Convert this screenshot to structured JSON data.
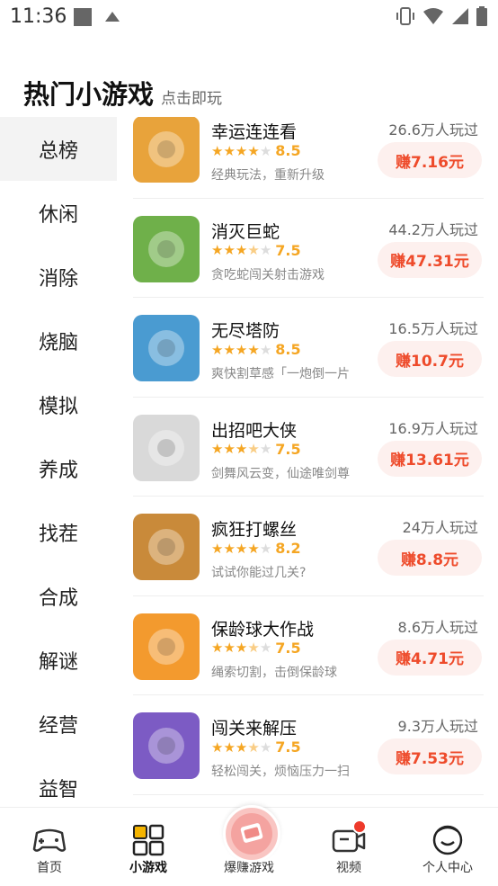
{
  "status": {
    "time": "11:36"
  },
  "header": {
    "title": "热门小游戏",
    "subtitle": "点击即玩"
  },
  "sidebar": {
    "items": [
      {
        "label": "总榜"
      },
      {
        "label": "休闲"
      },
      {
        "label": "消除"
      },
      {
        "label": "烧脑"
      },
      {
        "label": "模拟"
      },
      {
        "label": "养成"
      },
      {
        "label": "找茬"
      },
      {
        "label": "合成"
      },
      {
        "label": "解谜"
      },
      {
        "label": "经营"
      },
      {
        "label": "益智"
      }
    ]
  },
  "games": [
    {
      "name": "幸运连连看",
      "rating": "8.5",
      "stars": 4,
      "half": false,
      "desc": "经典玩法，重新升级",
      "players": "26.6万人玩过",
      "earn": "赚7.16元",
      "icon": "fruit-grid-icon",
      "color": "#e8a33b"
    },
    {
      "name": "消灭巨蛇",
      "rating": "7.5",
      "stars": 3,
      "half": true,
      "desc": "贪吃蛇闯关射击游戏",
      "players": "44.2万人玩过",
      "earn": "赚47.31元",
      "icon": "snake-icon",
      "color": "#6fb04a"
    },
    {
      "name": "无尽塔防",
      "rating": "8.5",
      "stars": 4,
      "half": false,
      "desc": "爽快割草感「一炮倒一片",
      "players": "16.5万人玩过",
      "earn": "赚10.7元",
      "icon": "soldier-icon",
      "color": "#4a9bd1"
    },
    {
      "name": "出招吧大侠",
      "rating": "7.5",
      "stars": 3,
      "half": true,
      "desc": "剑舞风云变，仙途唯剑尊",
      "players": "16.9万人玩过",
      "earn": "赚13.61元",
      "icon": "warrior-icon",
      "color": "#d9d9d9"
    },
    {
      "name": "疯狂打螺丝",
      "rating": "8.2",
      "stars": 4,
      "half": false,
      "desc": "试试你能过几关?",
      "players": "24万人玩过",
      "earn": "赚8.8元",
      "icon": "screw-board-icon",
      "color": "#c98a3a"
    },
    {
      "name": "保龄球大作战",
      "rating": "7.5",
      "stars": 3,
      "half": true,
      "desc": "绳索切割，击倒保龄球",
      "players": "8.6万人玩过",
      "earn": "赚4.71元",
      "icon": "bowling-icon",
      "color": "#f39a2e"
    },
    {
      "name": "闯关来解压",
      "rating": "7.5",
      "stars": 3,
      "half": true,
      "desc": "轻松闯关，烦恼压力一扫",
      "players": "9.3万人玩过",
      "earn": "赚7.53元",
      "icon": "bottles-icon",
      "color": "#7c5bc4"
    }
  ],
  "tabbar": {
    "items": [
      {
        "label": "首页"
      },
      {
        "label": "小游戏"
      },
      {
        "label": "爆赚游戏"
      },
      {
        "label": "视频"
      },
      {
        "label": "个人中心"
      }
    ]
  }
}
